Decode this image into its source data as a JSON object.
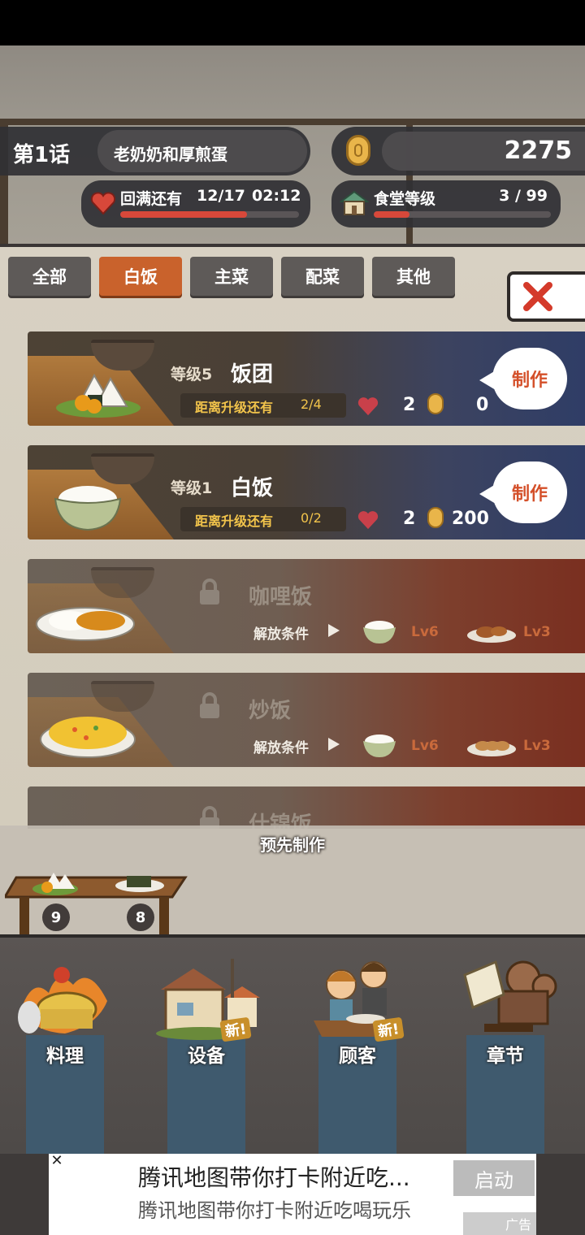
{
  "header": {
    "chapter": "第1话",
    "chapter_title": "老奶奶和厚煎蛋",
    "coins": "2275",
    "hearts_label": "回满还有",
    "hearts_count": "12/17",
    "hearts_timer": "02:12",
    "hearts_progress": 0.71,
    "canteen_label": "食堂等级",
    "canteen_level": "3 / 99",
    "canteen_progress": 0.2
  },
  "tabs": [
    "全部",
    "白饭",
    "主菜",
    "配菜",
    "其他"
  ],
  "active_tab": 1,
  "recipes": [
    {
      "level": "等级5",
      "name": "饭团",
      "progress_label": "距离升级还有",
      "progress": "2/4",
      "hearts": "2",
      "coins": "0",
      "button": "制作"
    },
    {
      "level": "等级1",
      "name": "白饭",
      "progress_label": "距离升级还有",
      "progress": "0/2",
      "hearts": "2",
      "coins": "200",
      "button": "制作"
    }
  ],
  "locked": [
    {
      "name": "咖哩饭",
      "condition": "解放条件",
      "req1": "Lv6",
      "req2": "Lv3"
    },
    {
      "name": "炒饭",
      "condition": "解放条件",
      "req1": "Lv6",
      "req2": "Lv3"
    },
    {
      "name": "什锦饭"
    }
  ],
  "premake": {
    "title": "预先制作",
    "counts": [
      "9",
      "8"
    ]
  },
  "nav": [
    {
      "label": "料理",
      "new": ""
    },
    {
      "label": "设备",
      "new": "新!"
    },
    {
      "label": "顾客",
      "new": "新!"
    },
    {
      "label": "章节",
      "new": ""
    }
  ],
  "ad": {
    "title": "腾讯地图带你打卡附近吃...",
    "subtitle": "腾讯地图带你打卡附近吃喝玩乐",
    "button": "启动",
    "tag": "广告",
    "close": "✕"
  },
  "colors": {
    "active_tab": "#c9622c",
    "make_text": "#d4502a",
    "heart": "#d7483a"
  }
}
